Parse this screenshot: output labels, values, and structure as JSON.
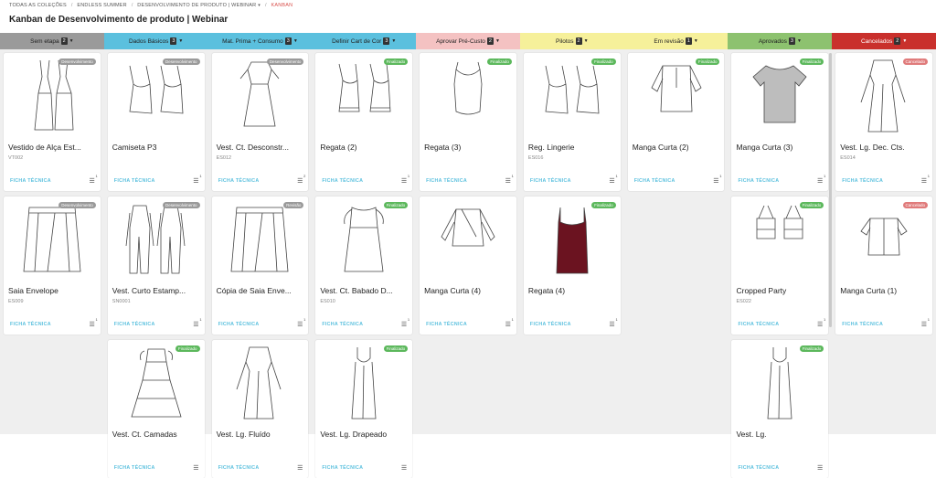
{
  "breadcrumb": {
    "items": [
      "TODAS AS COLEÇÕES",
      "ENDLESS SUMMER",
      "DESENVOLVIMENTO DE PRODUTO | WEBINAR",
      "KANBAN"
    ]
  },
  "page_title": "Kanban de Desenvolvimento de produto | Webinar",
  "ficha_label": "FICHA TÉCNICA",
  "columns": [
    {
      "title": "Sem etapa",
      "count": "2",
      "color": "#9a9a9a",
      "cards": [
        {
          "name": "Vestido de Alça Est...",
          "code": "VT002",
          "badge": "Desenvolvimento",
          "badge_type": "gray",
          "comments": "1",
          "sketch": "dress-strap"
        },
        {
          "name": "Saia Envelope",
          "code": "ES009",
          "badge": "Desenvolvimento",
          "badge_type": "gray",
          "comments": "1",
          "sketch": "skirt"
        }
      ]
    },
    {
      "title": "Dados Básicos",
      "count": "3",
      "color": "#5bc0de",
      "cards": [
        {
          "name": "Camiseta P3",
          "code": "",
          "badge": "Desenvolvimento",
          "badge_type": "gray",
          "comments": "1",
          "sketch": "cami"
        },
        {
          "name": "Vest. Curto Estamp...",
          "code": "SN0001",
          "badge": "Desenvolvimento",
          "badge_type": "gray",
          "comments": "1",
          "sketch": "jumpsuit"
        },
        {
          "name": "Vest. Ct. Camadas",
          "code": "",
          "badge": "Finalizado",
          "badge_type": "green",
          "comments": "",
          "sketch": "tiered"
        }
      ]
    },
    {
      "title": "Mat. Prima + Consumo",
      "count": "3",
      "color": "#5bc0de",
      "cards": [
        {
          "name": "Vest. Ct. Desconstr...",
          "code": "ES012",
          "badge": "Desenvolvimento",
          "badge_type": "gray",
          "comments": "2",
          "sketch": "dress-short"
        },
        {
          "name": "Cópia de Saia Enve...",
          "code": "",
          "badge": "Revisão",
          "badge_type": "gray",
          "comments": "1",
          "sketch": "skirt"
        },
        {
          "name": "Vest. Lg. Fluído",
          "code": "",
          "badge": "",
          "badge_type": "",
          "comments": "",
          "sketch": "long-dress"
        }
      ]
    },
    {
      "title": "Definir Cart de Cor",
      "count": "3",
      "color": "#5bc0de",
      "cards": [
        {
          "name": "Regata (2)",
          "code": "",
          "badge": "Finalizado",
          "badge_type": "green",
          "comments": "1",
          "sketch": "tank"
        },
        {
          "name": "Vest. Ct. Babado D...",
          "code": "ES010",
          "badge": "Finalizado",
          "badge_type": "green",
          "comments": "1",
          "sketch": "ruffle"
        },
        {
          "name": "Vest. Lg. Drapeado",
          "code": "",
          "badge": "Finalizado",
          "badge_type": "green",
          "comments": "",
          "sketch": "drape"
        }
      ]
    },
    {
      "title": "Aprovar Pré-Custo",
      "count": "2",
      "color": "#f4c2c2",
      "cards": [
        {
          "name": "Regata (3)",
          "code": "",
          "badge": "Finalizado",
          "badge_type": "green",
          "comments": "1",
          "sketch": "tank-round"
        },
        {
          "name": "Manga Curta (4)",
          "code": "",
          "badge": "",
          "badge_type": "",
          "comments": "1",
          "sketch": "blouse-wrap"
        }
      ]
    },
    {
      "title": "Pilotos",
      "count": "2",
      "color": "#f6f09a",
      "cards": [
        {
          "name": "Reg. Lingerie",
          "code": "ES016",
          "badge": "Finalizado",
          "badge_type": "green",
          "comments": "1",
          "sketch": "cami"
        },
        {
          "name": "Regata (4)",
          "code": "",
          "badge": "Finalizado",
          "badge_type": "green",
          "comments": "1",
          "sketch": "red-cami"
        }
      ]
    },
    {
      "title": "Em revisão",
      "count": "1",
      "color": "#f6f09a",
      "cards": [
        {
          "name": "Manga Curta (2)",
          "code": "",
          "badge": "Finalizado",
          "badge_type": "green",
          "comments": "1",
          "sketch": "blouse"
        }
      ]
    },
    {
      "title": "Aprovados",
      "count": "3",
      "color": "#8dc26f",
      "cards": [
        {
          "name": "Manga Curta (3)",
          "code": "",
          "badge": "Finalizado",
          "badge_type": "green",
          "comments": "1",
          "sketch": "tshirt"
        },
        {
          "name": "Cropped Party",
          "code": "ES022",
          "badge": "Finalizado",
          "badge_type": "green",
          "comments": "1",
          "sketch": "crop"
        },
        {
          "name": "Vest. Lg.",
          "code": "",
          "badge": "Finalizado",
          "badge_type": "green",
          "comments": "",
          "sketch": "drape"
        }
      ]
    },
    {
      "title": "Cancelados",
      "count": "2",
      "color": "#c9302c",
      "cards": [
        {
          "name": "Vest. Lg. Dec. Cts.",
          "code": "ES014",
          "badge": "Cancelado",
          "badge_type": "red",
          "comments": "1",
          "sketch": "long-dress"
        },
        {
          "name": "Manga Curta (1)",
          "code": "",
          "badge": "Cancelado",
          "badge_type": "red",
          "comments": "1",
          "sketch": "shirt"
        }
      ]
    }
  ]
}
